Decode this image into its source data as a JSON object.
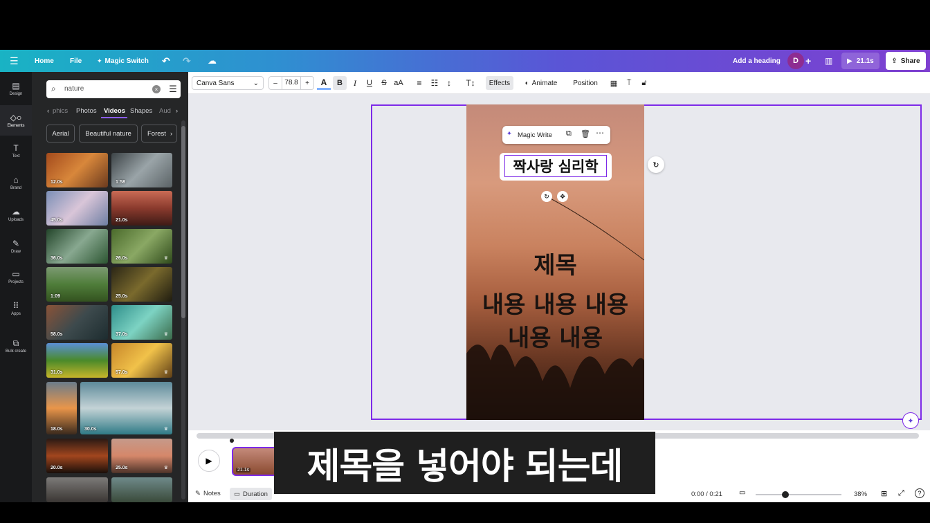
{
  "topbar": {
    "menu_icon": "hamburger-icon",
    "home": "Home",
    "file": "File",
    "magic_switch": "Magic Switch",
    "add_heading": "Add a heading",
    "avatar_letter": "D",
    "play_duration": "21.1s",
    "share": "Share"
  },
  "toolbar": {
    "font": "Canva Sans",
    "minus": "–",
    "font_size": "78.8",
    "plus": "+",
    "text_color_letter": "A",
    "bold": "B",
    "italic": "I",
    "underline": "U",
    "strike": "S",
    "case": "aA",
    "effects": "Effects",
    "animate": "Animate",
    "position": "Position"
  },
  "rail": [
    {
      "label": "Design",
      "icon": "design-icon"
    },
    {
      "label": "Elements",
      "icon": "elements-icon"
    },
    {
      "label": "Text",
      "icon": "text-icon"
    },
    {
      "label": "Brand",
      "icon": "brand-icon"
    },
    {
      "label": "Uploads",
      "icon": "upload-icon"
    },
    {
      "label": "Draw",
      "icon": "draw-icon"
    },
    {
      "label": "Projects",
      "icon": "folder-icon"
    },
    {
      "label": "Apps",
      "icon": "apps-icon"
    },
    {
      "label": "Bulk create",
      "icon": "bulk-create-icon"
    }
  ],
  "panel": {
    "search_value": "nature",
    "tabs": [
      "phics",
      "Photos",
      "Videos",
      "Shapes",
      "Aud"
    ],
    "active_tab": "Videos",
    "chips": [
      "Aerial",
      "Beautiful nature",
      "Forest"
    ],
    "videos": [
      "12.0s",
      "1:58",
      "45.0s",
      "21.0s",
      "36.0s",
      "26.0s",
      "1:09",
      "25.0s",
      "58.0s",
      "37.0s",
      "31.0s",
      "57.0s",
      "18.0s",
      "30.0s",
      "20.0s",
      "25.0s"
    ]
  },
  "canvas": {
    "magic_write": "Magic Write",
    "heading_text": "짝사랑 심리학",
    "title_text": "제목",
    "body_line1": "내용 내용 내용",
    "body_line2": "내용 내용"
  },
  "timeline": {
    "clip_duration": "21.1s",
    "notes": "Notes",
    "duration": "Duration",
    "time": "0:00 / 0:21",
    "zoom": "38%"
  },
  "subtitle": "제목을 넣어야 되는데",
  "colors": {
    "accent_purple": "#7d2ae8",
    "topbar_start": "#19b3c4",
    "topbar_end": "#7e3fd0",
    "panel_bg": "#252627",
    "rail_bg": "#18191b"
  }
}
